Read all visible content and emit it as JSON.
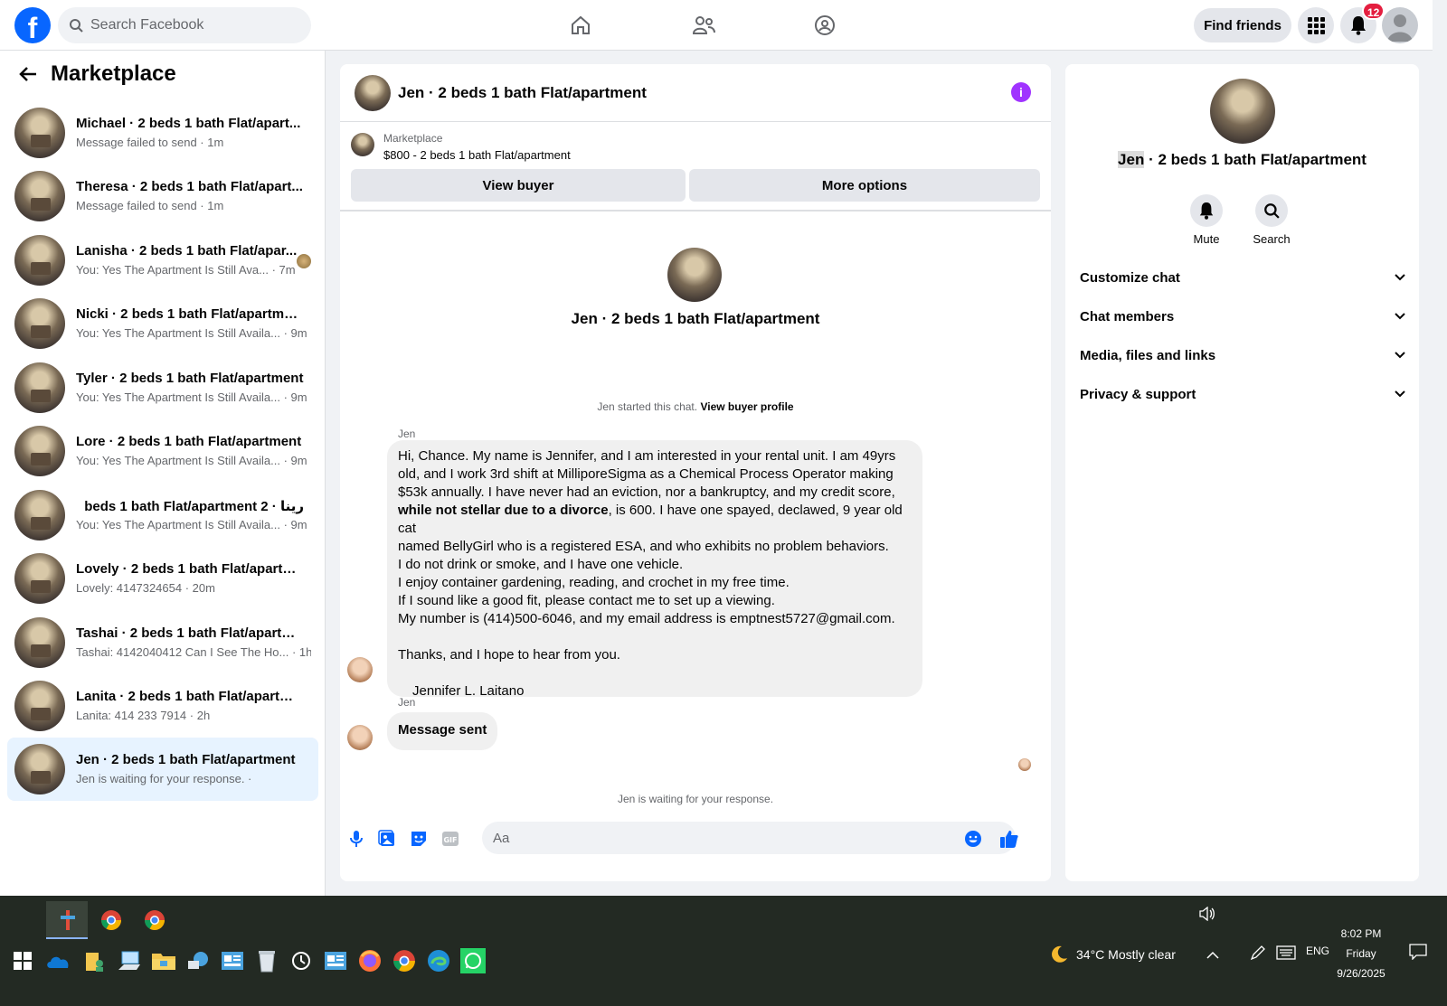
{
  "topbar": {
    "search_placeholder": "Search Facebook",
    "find_friends": "Find friends",
    "notification_count": "12",
    "logo_letter": "f"
  },
  "sidebar": {
    "title": "Marketplace",
    "conversations": [
      {
        "name": "Michael · 2 beds 1 bath Flat/apart...",
        "preview": "Message failed to send · 1m"
      },
      {
        "name": "Theresa · 2 beds 1 bath Flat/apart...",
        "preview": "Message failed to send · 1m"
      },
      {
        "name": "Lanisha · 2 beds 1 bath Flat/apar...",
        "preview": "You: Yes The Apartment Is Still Ava... · 7m"
      },
      {
        "name": "Nicki · 2 beds 1 bath Flat/apartment",
        "preview": "You: Yes The Apartment Is Still Availa... · 9m"
      },
      {
        "name": "Tyler · 2 beds 1 bath Flat/apartment",
        "preview": "You: Yes The Apartment Is Still Availa... · 9m"
      },
      {
        "name": "Lore · 2 beds 1 bath Flat/apartment",
        "preview": "You: Yes The Apartment Is Still Availa... · 9m"
      },
      {
        "name": "رينا · 2 beds 1 bath Flat/apartment",
        "preview": "You: Yes The Apartment Is Still Availa... · 9m"
      },
      {
        "name": "Lovely · 2 beds 1 bath Flat/apartm...",
        "preview": "Lovely: 4147324654 · 20m"
      },
      {
        "name": "Tashai · 2 beds 1 bath Flat/apartme...",
        "preview": "Tashai: 4142040412 Can I See The Ho... · 1h"
      },
      {
        "name": "Lanita · 2 beds 1 bath Flat/apartme...",
        "preview": "Lanita: 414 233 7914 · 2h"
      },
      {
        "name": "Jen · 2 beds 1 bath Flat/apartment",
        "preview": "Jen is waiting for your response. ·"
      }
    ]
  },
  "chat": {
    "title": "Jen · 2 beds 1 bath Flat/apartment",
    "marketplace_label": "Marketplace",
    "listing": "$800 - 2 beds 1 bath Flat/apartment",
    "view_buyer": "View buyer",
    "more_options": "More options",
    "center_name": "Jen · 2 beds 1 bath Flat/apartment",
    "started_text": "Jen started this chat.",
    "view_buyer_profile": "View buyer profile",
    "sender1": "Jen",
    "message_lines": [
      "Hi, Chance. My name is Jennifer, and I am interested in your rental unit. I am 49yrs",
      "old, and I work 3rd shift at MilliporeSigma as a Chemical Process Operator making",
      "$53k annually. I have never had an eviction, nor a bankruptcy, and my credit score,",
      "while not stellar due to a divorce",
      ", is 600. I have one spayed, declawed, 9 year old cat",
      "named BellyGirl who is a registered ESA, and who exhibits no problem behaviors.",
      "I do not drink or smoke, and I have one vehicle.",
      "I enjoy container gardening, reading, and crochet in my free time.",
      "If I sound like a good fit, please contact me to set up a viewing.",
      "My number is (414)500-6046, and my email address is emptnest5727@gmail.com.",
      "",
      "Thanks, and I hope to hear from you.",
      "",
      "Jennifer L. Laitano"
    ],
    "sender2": "Jen",
    "message2": "Message sent",
    "waiting": "Jen is waiting for your response.",
    "composer_placeholder": "Aa"
  },
  "info": {
    "name_first": "Jen",
    "name_rest": " · 2 beds 1 bath Flat/apartment",
    "mute": "Mute",
    "search": "Search",
    "sections": [
      "Customize chat",
      "Chat members",
      "Media, files and links",
      "Privacy & support"
    ]
  },
  "taskbar": {
    "weather": "34°C  Mostly clear",
    "lang": "ENG",
    "time": "8:02 PM",
    "day": "Friday",
    "date": "9/26/2025"
  },
  "colors": {
    "brand": "#0866ff",
    "accent_purple": "#a033ff",
    "badge_red": "#e41e3f",
    "active_row": "#e7f3ff"
  }
}
